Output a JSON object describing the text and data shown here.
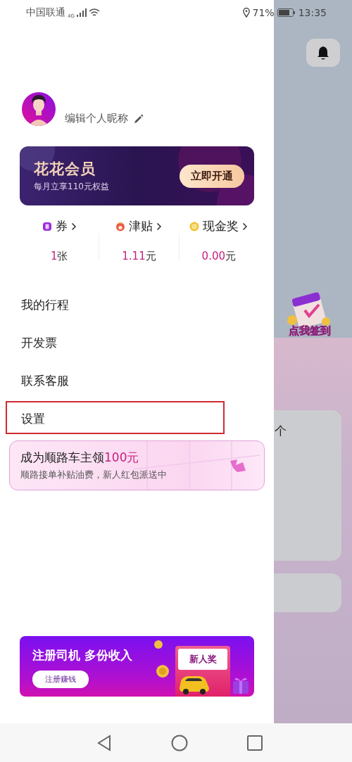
{
  "status_bar": {
    "carrier": "中国联通",
    "network": "4G",
    "battery": "71%",
    "time": "13:35"
  },
  "profile": {
    "nickname_prompt": "编辑个人昵称"
  },
  "membership": {
    "title": "花花会员",
    "subtitle": "每月立享110元权益",
    "button": "立即开通"
  },
  "stats": [
    {
      "kind": "coupon",
      "label": "券",
      "value": "1",
      "unit": "张"
    },
    {
      "kind": "bag",
      "label": "津贴",
      "value": "1.11",
      "unit": "元"
    },
    {
      "kind": "coin",
      "label": "现金奖",
      "value": "0.00",
      "unit": "元"
    }
  ],
  "menu": [
    {
      "label": "我的行程",
      "highlighted": false
    },
    {
      "label": "开发票",
      "highlighted": false
    },
    {
      "label": "联系客服",
      "highlighted": false
    },
    {
      "label": "设置",
      "highlighted": true
    }
  ],
  "driver_promo": {
    "title": "成为顺路车主领",
    "amount": "100元",
    "subtitle": "顺路接单补贴油费，新人红包派送中"
  },
  "driver_banner": {
    "title": "注册司机 多份收入",
    "button": "注册赚钱",
    "envelope_label": "新人奖"
  },
  "background": {
    "sign_in_label": "点我签到",
    "card_text": "个"
  }
}
